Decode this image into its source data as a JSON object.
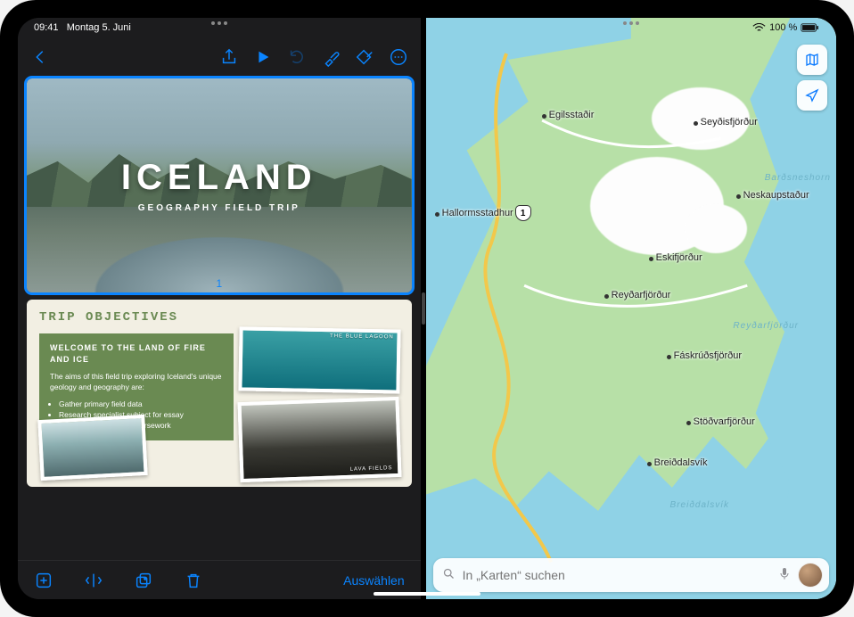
{
  "statusbar": {
    "time": "09:41",
    "date": "Montag 5. Juni",
    "battery": "100 %"
  },
  "keynote": {
    "slide1": {
      "title": "ICELAND",
      "subtitle": "GEOGRAPHY FIELD TRIP",
      "number": "1"
    },
    "slide2": {
      "heading": "TRIP OBJECTIVES",
      "welcome": "WELCOME TO THE LAND OF FIRE AND ICE",
      "intro": "The aims of this field trip exploring Iceland's unique geology and geography are:",
      "bullet1": "Gather primary field data",
      "bullet2": "Research specialist subject for essay",
      "bullet3": "Use data as basis for coursework",
      "caption_a": "THE BLUE LAGOON",
      "caption_b": "LAVA FIELDS"
    },
    "select_label": "Auswählen"
  },
  "maps": {
    "search_placeholder": "In „Karten“ suchen",
    "route_number": "1",
    "cities": {
      "egilsstadir": "Egilsstaðir",
      "seydisfjordur": "Seyðisfjörður",
      "neskaupstadur": "Neskaupstaður",
      "eskifjordur": "Eskifjörður",
      "reydarfjordur": "Reyðarfjörður",
      "faskrudsfjordur": "Fáskrúðsfjörður",
      "stodvarfjordur": "Stöðvarfjörður",
      "breiddalsvik": "Breiðdalsvík",
      "hallormsstadhur": "Hallormsstadhur"
    },
    "sealabels": {
      "bardsnes": "Barðsneshorn",
      "reydarfj": "Reyðarfjörður",
      "breiddalsvik": "Breiðdalsvík"
    }
  }
}
